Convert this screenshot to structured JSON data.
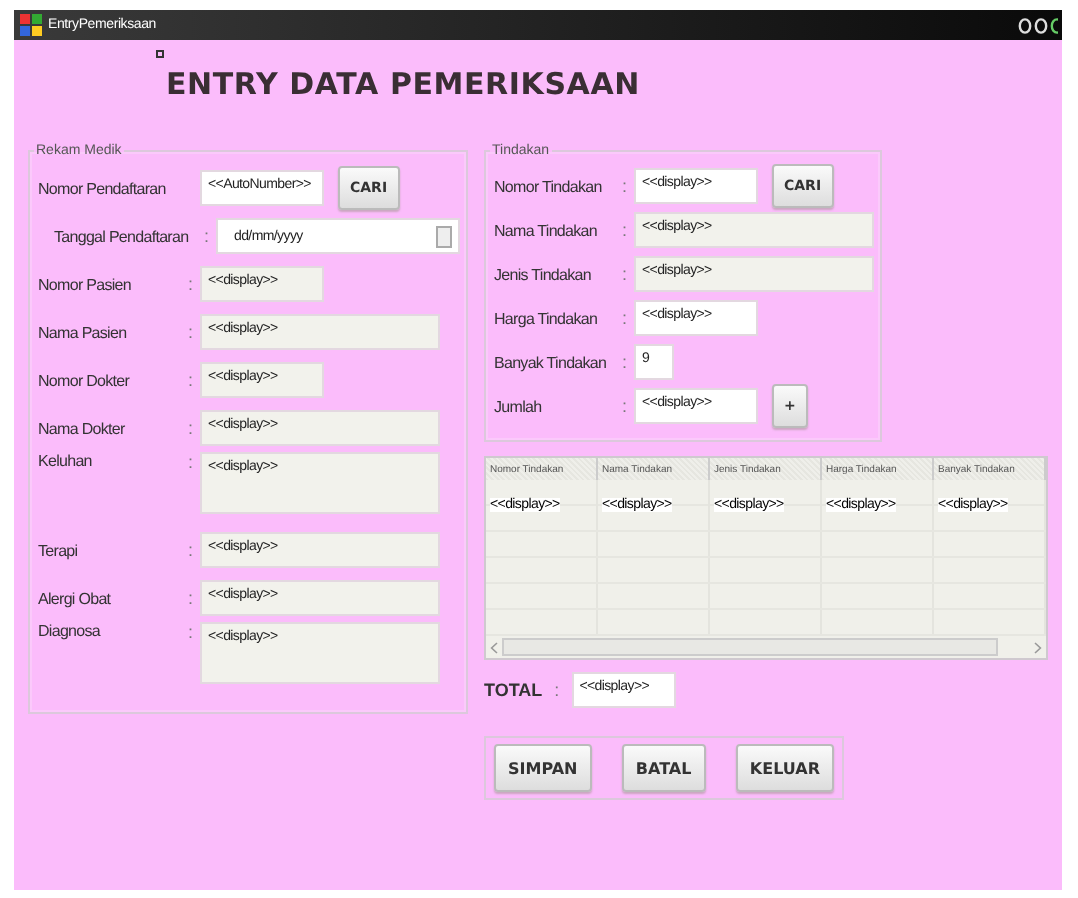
{
  "window": {
    "title": "EntryPemeriksaan"
  },
  "heading": "ENTRY DATA PEMERIKSAAN",
  "rekam_medik": {
    "legend": "Rekam Medik",
    "rows": [
      {
        "label": "Nomor Pendaftaran",
        "kind": "short",
        "value": "<<AutoNumber>>",
        "editable": true,
        "button": "CARI"
      },
      {
        "label": "Tanggal Pendaftaran",
        "separator": ":",
        "kind": "date",
        "value": "dd/mm/yyyy",
        "editable": true
      },
      {
        "label": "Nomor Pasien",
        "separator": ":",
        "kind": "short",
        "value": "<<display>>",
        "editable": false
      },
      {
        "label": "Nama Pasien",
        "separator": ":",
        "kind": "long",
        "value": "<<display>>",
        "editable": false
      },
      {
        "label": "Nomor Dokter",
        "separator": ":",
        "kind": "short",
        "value": "<<display>>",
        "editable": false
      },
      {
        "label": "Nama Dokter",
        "separator": ":",
        "kind": "long",
        "value": "<<display>>",
        "editable": false
      },
      {
        "label": "Keluhan",
        "separator": ":",
        "kind": "area",
        "value": "<<display>>",
        "editable": false
      },
      {
        "label": "Terapi",
        "separator": ":",
        "kind": "long",
        "value": "<<display>>",
        "editable": false
      },
      {
        "label": "Alergi Obat",
        "separator": ":",
        "kind": "long",
        "value": "<<display>>",
        "editable": false
      },
      {
        "label": "Diagnosa",
        "separator": ":",
        "kind": "area",
        "value": "<<display>>",
        "editable": false
      }
    ]
  },
  "tindakan": {
    "legend": "Tindakan",
    "rows": [
      {
        "label": "Nomor Tindakan",
        "separator": ":",
        "kind": "short",
        "value": "<<display>>",
        "editable": true,
        "button": "CARI"
      },
      {
        "label": "Nama Tindakan",
        "separator": ":",
        "kind": "long",
        "value": "<<display>>",
        "editable": false
      },
      {
        "label": "Jenis Tindakan",
        "separator": ":",
        "kind": "long",
        "value": "<<display>>",
        "editable": false
      },
      {
        "label": "Harga Tindakan",
        "separator": ":",
        "kind": "short",
        "value": "<<display>>",
        "editable": true
      },
      {
        "label": "Banyak Tindakan",
        "separator": ":",
        "kind": "tiny",
        "value": "9",
        "editable": true
      },
      {
        "label": "Jumlah",
        "separator": ":",
        "kind": "short",
        "value": "<<display>>",
        "editable": true,
        "button": "+"
      }
    ]
  },
  "table": {
    "columns": [
      "Nomor Tindakan",
      "Nama Tindakan",
      "Jenis Tindakan",
      "Harga Tindakan",
      "Banyak Tindakan"
    ],
    "rows": [
      [
        "<<display>>",
        "<<display>>",
        "<<display>>",
        "<<display>>",
        "<<display>>"
      ]
    ]
  },
  "total": {
    "label": "TOTAL",
    "separator": ":",
    "value": "<<display>>"
  },
  "buttons": [
    "SIMPAN",
    "BATAL",
    "KELUAR"
  ]
}
